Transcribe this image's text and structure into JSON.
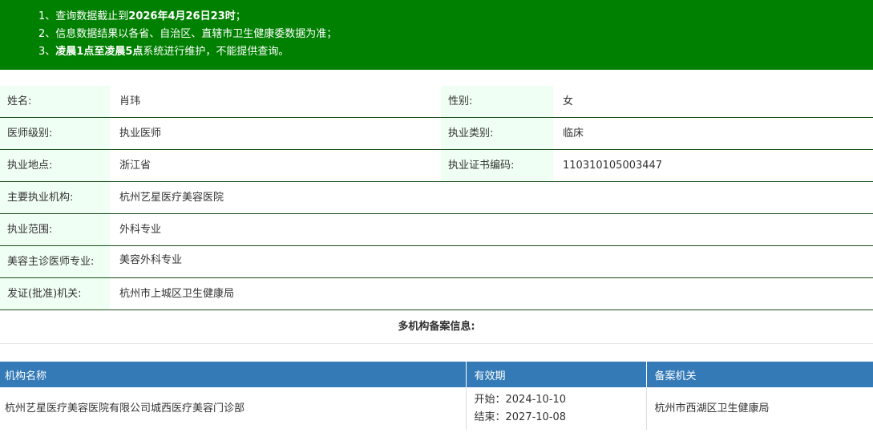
{
  "notice": {
    "line1_prefix": "1、查询数据截止到",
    "line1_bold": "2026年4月26日23时",
    "line1_suffix": "；",
    "line2": "2、信息数据结果以各省、自治区、直辖市卫生健康委数据为准；",
    "line3_prefix": "3、",
    "line3_bold": "凌晨1点至凌晨5点",
    "line3_suffix": "系统进行维护，不能提供查询。"
  },
  "info": {
    "name_label": "姓名:",
    "name_value": "肖玮",
    "gender_label": "性别:",
    "gender_value": "女",
    "level_label": "医师级别:",
    "level_value": "执业医师",
    "category_label": "执业类别:",
    "category_value": "临床",
    "location_label": "执业地点:",
    "location_value": "浙江省",
    "cert_label": "执业证书编码:",
    "cert_value": "110310105003447",
    "institution_label": "主要执业机构:",
    "institution_value": "杭州艺星医疗美容医院",
    "scope_label": "执业范围:",
    "scope_value": "外科专业",
    "cosmetic_label": "美容主诊医师专业:",
    "cosmetic_value": "美容外科专业",
    "issuer_label": "发证(批准)机关:",
    "issuer_value": "杭州市上城区卫生健康局"
  },
  "multi": {
    "title": "多机构备案信息:",
    "headers": [
      "机构名称",
      "有效期",
      "备案机关"
    ],
    "rows": [
      {
        "institution": "杭州艺星医疗美容医院有限公司城西医疗美容门诊部",
        "start": "开始：2024-10-10",
        "end": "结束：2027-10-08",
        "agency": "杭州市西湖区卫生健康局"
      }
    ]
  }
}
